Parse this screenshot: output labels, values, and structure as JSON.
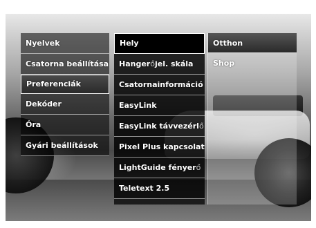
{
  "menu": {
    "column1": [
      {
        "label": "Nyelvek",
        "selected": false
      },
      {
        "label": "Csatorna beállítása",
        "selected": false
      },
      {
        "label": "Preferenciák",
        "selected": true
      },
      {
        "label": "Dekóder",
        "selected": false
      },
      {
        "label": "Óra",
        "selected": false
      },
      {
        "label": "Gyári beállítások",
        "selected": false
      }
    ],
    "column2": [
      {
        "label": "Hely",
        "selected": true
      },
      {
        "label": "Hanger",
        "suffix": "ő",
        "label2": "jel. skála",
        "selected": false
      },
      {
        "label": "Csatornainformáció méret",
        "selected": false
      },
      {
        "label": "EasyLink",
        "selected": false
      },
      {
        "label": "EasyLink távvezérl",
        "suffix": "ő",
        "selected": false
      },
      {
        "label": "Pixel Plus kapcsolat",
        "selected": false
      },
      {
        "label": "LightGuide fényer",
        "suffix": "ő",
        "selected": false
      },
      {
        "label": "Teletext 2.5",
        "selected": false
      }
    ],
    "column3": [
      {
        "label": "Otthon",
        "selected": true
      },
      {
        "label": "Shop",
        "selected": false
      }
    ]
  },
  "colors": {
    "menu_text": "#ffffff",
    "selection_border": "#ffffff"
  }
}
